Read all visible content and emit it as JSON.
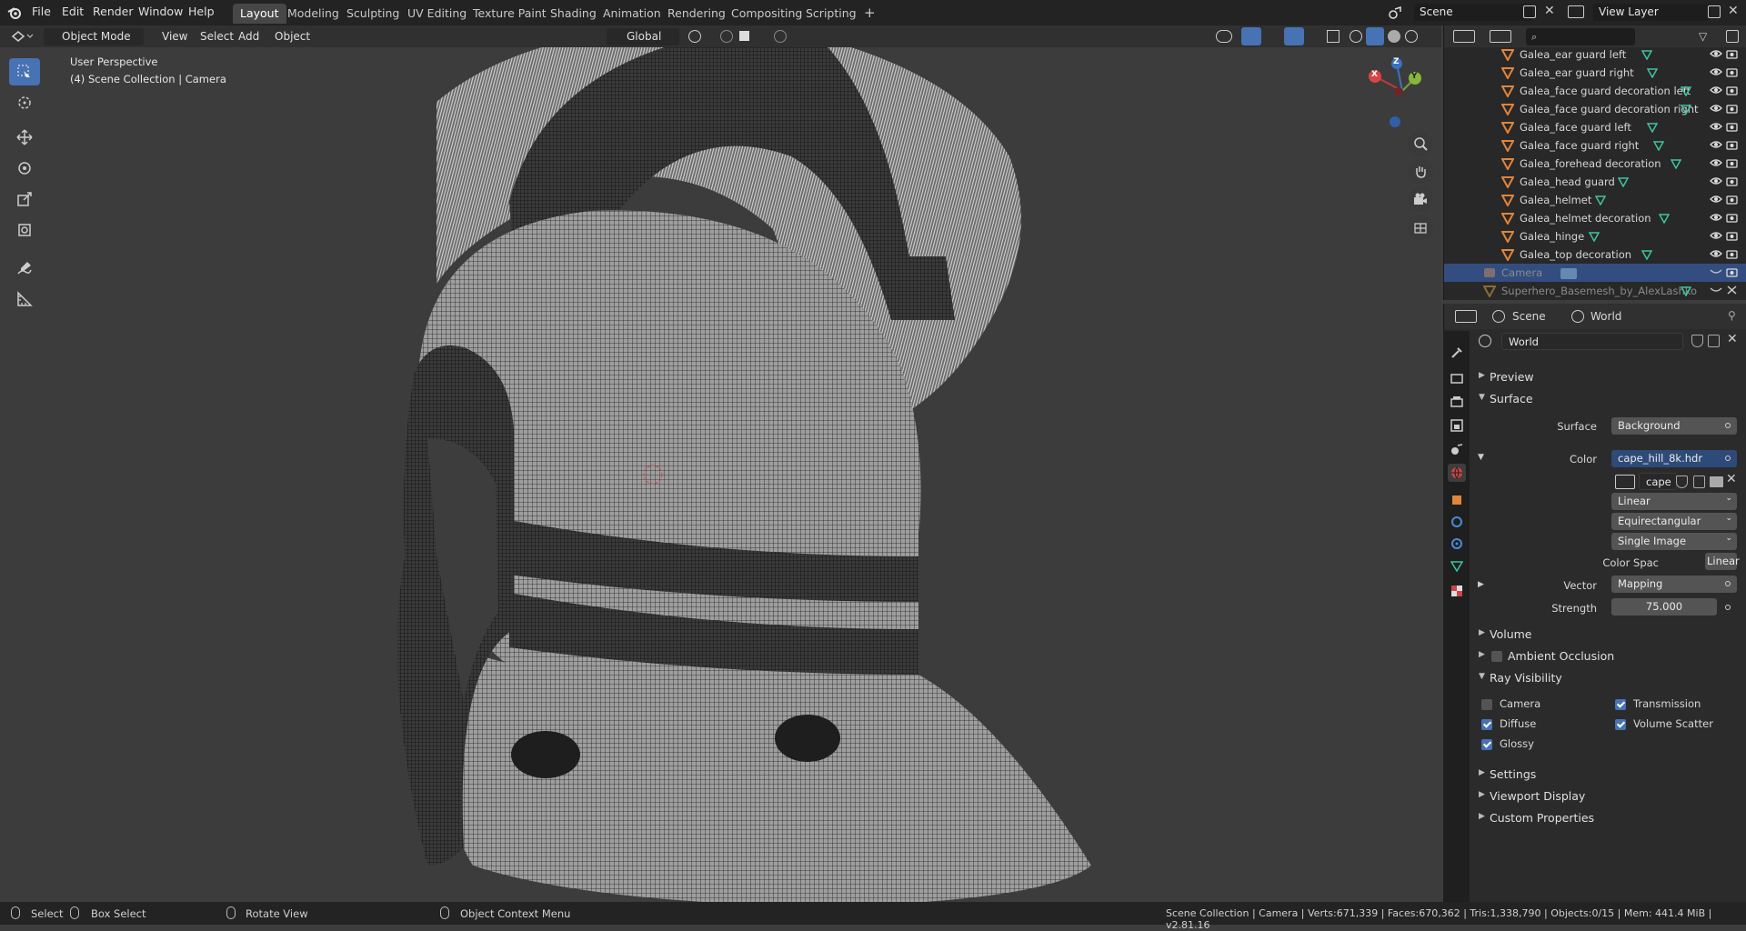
{
  "topbar": {
    "menus": [
      "File",
      "Edit",
      "Render",
      "Window",
      "Help"
    ],
    "workspaces": [
      "Layout",
      "Modeling",
      "Sculpting",
      "UV Editing",
      "Texture Paint",
      "Shading",
      "Animation",
      "Rendering",
      "Compositing",
      "Scripting"
    ],
    "active_workspace": "Layout",
    "add_tab": "+",
    "scene": "Scene",
    "view_layer": "View Layer"
  },
  "viewport_header": {
    "mode": "Object Mode",
    "menus": [
      "View",
      "Select",
      "Add",
      "Object"
    ],
    "transform_orientation": "Global"
  },
  "viewport": {
    "perspective": "User Perspective",
    "collection_info": "(4) Scene Collection | Camera",
    "gizmo": {
      "x": "X",
      "y": "Y",
      "z": "Z"
    }
  },
  "outliner": {
    "search_placeholder": "",
    "items": [
      {
        "label": "Galea_ear guard left"
      },
      {
        "label": "Galea_ear guard right"
      },
      {
        "label": "Galea_face guard decoration left"
      },
      {
        "label": "Galea_face guard decoration right"
      },
      {
        "label": "Galea_face guard left"
      },
      {
        "label": "Galea_face guard right"
      },
      {
        "label": "Galea_forehead decoration"
      },
      {
        "label": "Galea_head guard"
      },
      {
        "label": "Galea_helmet"
      },
      {
        "label": "Galea_helmet decoration"
      },
      {
        "label": "Galea_hinge"
      },
      {
        "label": "Galea_top decoration"
      },
      {
        "label": "Camera",
        "selected": true
      },
      {
        "label": "Superhero_Basemesh_by_AlexLashko"
      }
    ]
  },
  "properties": {
    "breadcrumb_scene": "Scene",
    "breadcrumb_world": "World",
    "world_name": "World",
    "panels": {
      "preview": "Preview",
      "surface": "Surface",
      "volume": "Volume",
      "ambient_occlusion": "Ambient Occlusion",
      "ray_visibility": "Ray Visibility",
      "settings": "Settings",
      "viewport_display": "Viewport Display",
      "custom_properties": "Custom Properties"
    },
    "surface": {
      "surface_label": "Surface",
      "surface_value": "Background",
      "color_label": "Color",
      "color_value": "cape_hill_8k.hdr",
      "image_name": "cape",
      "interpolation": "Linear",
      "projection": "Equirectangular",
      "source": "Single Image",
      "color_space_label": "Color Spac",
      "color_space_value": "Linear",
      "vector_label": "Vector",
      "vector_value": "Mapping",
      "strength_label": "Strength",
      "strength_value": "75.000"
    },
    "ray_visibility": {
      "camera": {
        "label": "Camera",
        "checked": false
      },
      "transmission": {
        "label": "Transmission",
        "checked": true
      },
      "diffuse": {
        "label": "Diffuse",
        "checked": true
      },
      "volume_scatter": {
        "label": "Volume Scatter",
        "checked": true
      },
      "glossy": {
        "label": "Glossy",
        "checked": true
      }
    },
    "ambient_occlusion_checked": false
  },
  "statusbar": {
    "select": "Select",
    "box_select": "Box Select",
    "rotate_view": "Rotate View",
    "context_menu": "Object Context Menu",
    "stats": "Scene Collection | Camera | Verts:671,339 | Faces:670,362 | Tris:1,338,790 | Objects:0/15 | Mem: 441.4 MiB | v2.81.16"
  },
  "colors": {
    "accent": "#4772b3",
    "mesh_icon": "#e0853b",
    "vertex_group_icon": "#3fc2a0",
    "background": "#3c3c3c"
  }
}
